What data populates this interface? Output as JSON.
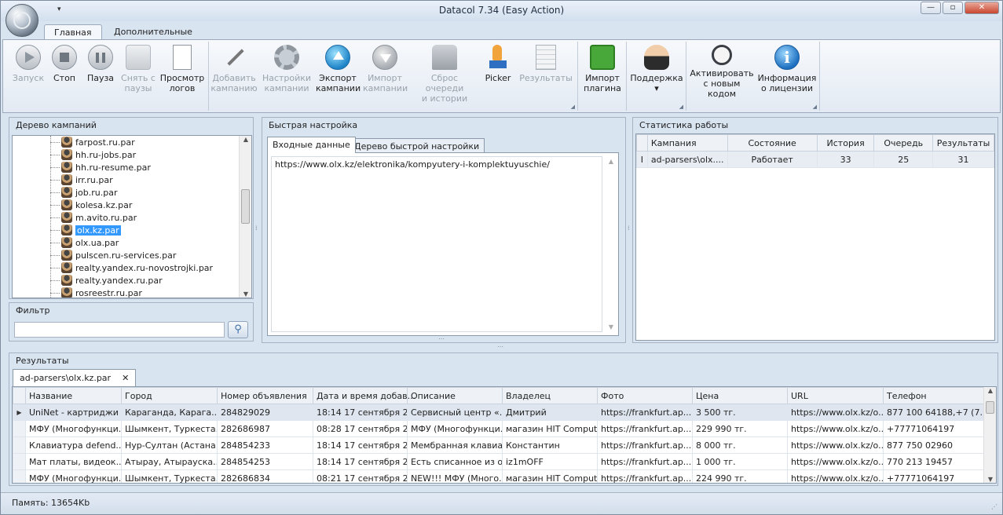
{
  "app": {
    "title": "Datacol 7.34 (Easy Action)",
    "qat_glyph": "▾"
  },
  "window_buttons": {
    "minimize": "—",
    "maximize": "▫",
    "close": "✕"
  },
  "ribbon_tabs": [
    "Главная",
    "Дополнительные"
  ],
  "ribbon": {
    "control": [
      {
        "label": "Запуск",
        "icon": "play-icon",
        "disabled": true
      },
      {
        "label": "Стоп",
        "icon": "stop-icon",
        "disabled": false
      },
      {
        "label": "Пауза",
        "icon": "pause-icon",
        "disabled": false
      },
      {
        "label": "Снять с\nпаузы",
        "icon": "resume-icon",
        "disabled": true
      },
      {
        "label": "Просмотр\nлогов",
        "icon": "log-icon",
        "disabled": false
      }
    ],
    "campaign": [
      {
        "label": "Добавить\nкампанию",
        "icon": "wand-icon",
        "disabled": true
      },
      {
        "label": "Настройки\nкампании",
        "icon": "gear-icon",
        "disabled": true
      },
      {
        "label": "Экспорт\nкампании",
        "icon": "export-icon",
        "disabled": false
      },
      {
        "label": "Импорт\nкампании",
        "icon": "import-icon",
        "disabled": true
      },
      {
        "label": "Сброс очереди\nи истории",
        "icon": "reset-icon",
        "disabled": true
      },
      {
        "label": "Picker",
        "icon": "picker-icon",
        "disabled": false
      },
      {
        "label": "Результаты",
        "icon": "results-icon",
        "disabled": true
      }
    ],
    "plugin": [
      {
        "label": "Импорт\nплагина",
        "icon": "plugin-icon",
        "disabled": false
      }
    ],
    "support": [
      {
        "label": "Поддержка",
        "icon": "support-icon",
        "disabled": false,
        "dropdown": "▾"
      }
    ],
    "license": [
      {
        "label": "Активировать\nс новым кодом",
        "icon": "key-icon",
        "disabled": false
      },
      {
        "label": "Информация\nо лицензии",
        "icon": "info-icon",
        "disabled": false
      }
    ],
    "launcher_glyph": "◢"
  },
  "tree_panel": {
    "title": "Дерево кампаний",
    "items": [
      "farpost.ru.par",
      "hh.ru-jobs.par",
      "hh.ru-resume.par",
      "irr.ru.par",
      "job.ru.par",
      "kolesa.kz.par",
      "m.avito.ru.par",
      "olx.kz.par",
      "olx.ua.par",
      "pulscen.ru-services.par",
      "realty.yandex.ru-novostrojki.par",
      "realty.yandex.ru.par",
      "rosreestr.ru.par"
    ],
    "selected_index": 7,
    "scroll_up": "▲",
    "scroll_down": "▼"
  },
  "filter_panel": {
    "title": "Фильтр",
    "value": "",
    "search_glyph": "⚲"
  },
  "quick_panel": {
    "title": "Быстрая настройка",
    "tabs": [
      "Входные данные",
      "Дерево быстрой настройки"
    ],
    "input_text": "https://www.olx.kz/elektronika/kompyutery-i-komplektuyuschie/"
  },
  "stats_panel": {
    "title": "Статистика работы",
    "columns": [
      "Кампания",
      "Состояние",
      "История",
      "Очередь",
      "Результаты"
    ],
    "rows": [
      {
        "marker": "I",
        "campaign": "ad-parsers\\olx....",
        "state": "Работает",
        "history": "33",
        "queue": "25",
        "results": "31"
      }
    ]
  },
  "results_panel": {
    "title": "Результаты",
    "tab": "ad-parsers\\olx.kz.par",
    "tab_close": "✕",
    "columns": [
      "Название",
      "Город",
      "Номер объявления",
      "Дата и время добав...",
      "Описание",
      "Владелец",
      "Фото",
      "Цена",
      "URL",
      "Телефон"
    ],
    "current_row_marker": "▶",
    "rows": [
      [
        "UniNet - картриджи ...",
        "Караганда, Карага...",
        "284829029",
        "18:14 17 сентября 2...",
        "Сервисный центр «...",
        "Дмитрий",
        "https://frankfurt.ap...",
        "3 500 тг.",
        "https://www.olx.kz/o...",
        "877 100 64188,+7 (7..."
      ],
      [
        "МФУ (Многофункци...",
        "Шымкент, Туркеста...",
        "282686987",
        "08:28 17 сентября 2...",
        "МФУ (Многофункци...",
        "магазин HIT Computers",
        "https://frankfurt.ap...",
        "229 990 тг.",
        "https://www.olx.kz/o...",
        "+77771064197"
      ],
      [
        "Клавиатура defend...",
        "Нур-Султан (Астана...",
        "284854233",
        "18:14 17 сентября 2...",
        "Мембранная клавиа...",
        "Константин",
        "https://frankfurt.ap...",
        "8 000 тг.",
        "https://www.olx.kz/o...",
        "877 750 02960"
      ],
      [
        "Мат платы, видеок...",
        "Атырау, Атырауска...",
        "284854253",
        "18:14 17 сентября 2...",
        "Есть списанное из о...",
        "iz1mOFF",
        "https://frankfurt.ap...",
        "1 000 тг.",
        "https://www.olx.kz/o...",
        "770 213 19457"
      ],
      [
        "МФУ (Многофункци...",
        "Шымкент, Туркеста...",
        "282686834",
        "08:21 17 сентября 2...",
        "NEW!!! МФУ (Много...",
        "магазин HIT Computers",
        "https://frankfurt.ap...",
        "224 990 тг.",
        "https://www.olx.kz/o...",
        "+77771064197"
      ]
    ]
  },
  "status": {
    "memory": "Память: 13654Kb"
  }
}
